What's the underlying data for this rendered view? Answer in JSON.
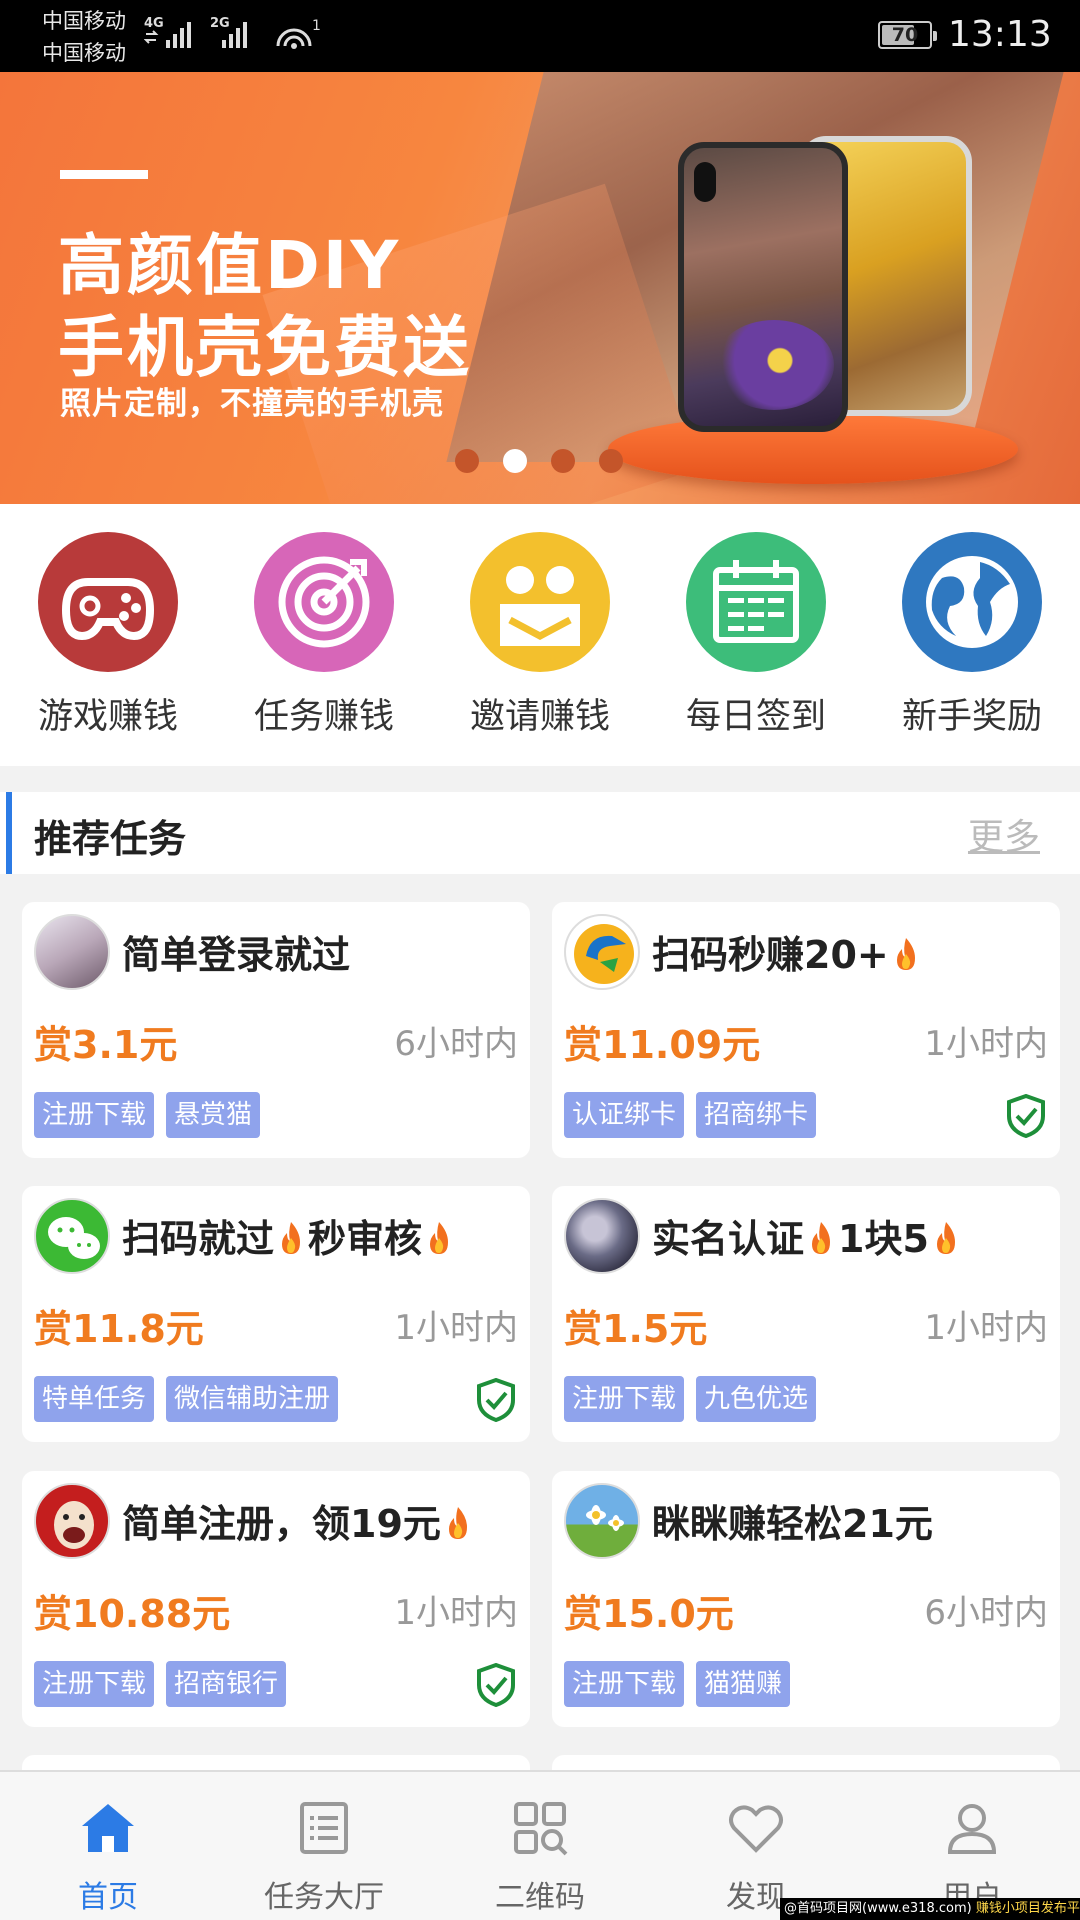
{
  "status": {
    "carrier1": "中国移动",
    "carrier2": "中国移动",
    "net1": "4G",
    "net2": "2G",
    "battery": "70",
    "battery_level": 0.7,
    "time": "13:13"
  },
  "banner": {
    "line1": "高颜值DIY",
    "line2": "手机壳免费送",
    "line3": "照片定制，不撞壳的手机壳",
    "dot_count": 4,
    "active_dot": 1
  },
  "quick": [
    {
      "label": "游戏赚钱",
      "color": "#b83a3a",
      "icon": "gamepad-icon"
    },
    {
      "label": "任务赚钱",
      "color": "#d766b8",
      "icon": "target-icon"
    },
    {
      "label": "邀请赚钱",
      "color": "#f3c02d",
      "icon": "invite-icon"
    },
    {
      "label": "每日签到",
      "color": "#3dbd7a",
      "icon": "calendar-icon"
    },
    {
      "label": "新手奖励",
      "color": "#2f78c0",
      "icon": "globe-icon"
    }
  ],
  "section": {
    "title": "推荐任务",
    "more": "更多"
  },
  "tasks": [
    {
      "title": "简单登录就过",
      "reward": "赏3.1元",
      "time": "6小时内",
      "tags": [
        "注册下载",
        "悬赏猫"
      ],
      "verified": false
    },
    {
      "title_parts": [
        "扫码秒赚20+"
      ],
      "reward": "赏11.09元",
      "time": "1小时内",
      "tags": [
        "认证绑卡",
        "招商绑卡"
      ],
      "verified": true
    },
    {
      "title_parts": [
        "扫码就过",
        "秒审核"
      ],
      "reward": "赏11.8元",
      "time": "1小时内",
      "tags": [
        "特单任务",
        "微信辅助注册"
      ],
      "verified": true
    },
    {
      "title_parts": [
        "实名认证",
        "1块5"
      ],
      "reward": "赏1.5元",
      "time": "1小时内",
      "tags": [
        "注册下载",
        "九色优选"
      ],
      "verified": false
    },
    {
      "title_parts": [
        "简单注册，领19元"
      ],
      "reward": "赏10.88元",
      "time": "1小时内",
      "tags": [
        "注册下载",
        "招商银行"
      ],
      "verified": true
    },
    {
      "title": "眯眯赚轻松21元",
      "reward": "赏15.0元",
      "time": "6小时内",
      "tags": [
        "注册下载",
        "猫猫赚"
      ],
      "verified": false
    }
  ],
  "nav": [
    {
      "label": "首页",
      "icon": "home-icon",
      "active": true
    },
    {
      "label": "任务大厅",
      "icon": "list-icon",
      "active": false
    },
    {
      "label": "二维码",
      "icon": "qrcode-icon",
      "active": false
    },
    {
      "label": "发现",
      "icon": "heart-icon",
      "active": false
    },
    {
      "label": "用户",
      "icon": "user-icon",
      "active": false
    }
  ],
  "watermark": {
    "left": "@首码项目网(www.e318.com)",
    "right": "赚钱小项目发布平台"
  },
  "colors": {
    "accent": "#2c7be5",
    "reward": "#f07b1f",
    "tag": "#8fa3ec",
    "verified": "#1e8f3a"
  }
}
